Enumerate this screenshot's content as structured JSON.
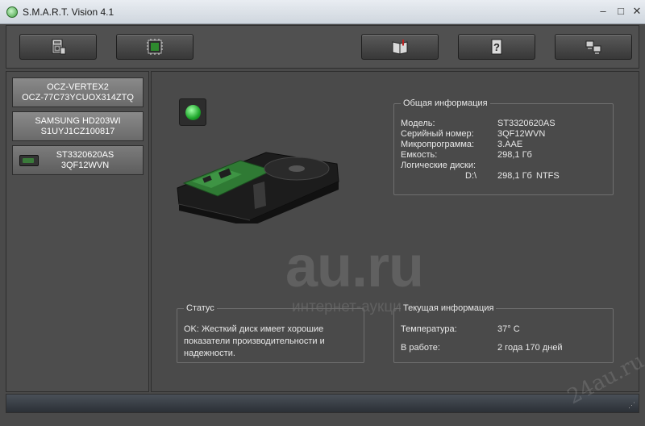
{
  "window": {
    "title": "S.M.A.R.T. Vision 4.1",
    "controls": {
      "minimize": "–",
      "maximize": "□",
      "close": "✕"
    }
  },
  "toolbar": {
    "buttons": [
      {
        "id": "drives",
        "icon": "hdd-properties-icon"
      },
      {
        "id": "smart",
        "icon": "chip-icon"
      },
      {
        "id": "book",
        "icon": "book-icon"
      },
      {
        "id": "help",
        "icon": "help-icon"
      },
      {
        "id": "network",
        "icon": "computers-icon"
      }
    ]
  },
  "drives": [
    {
      "line1": "OCZ-VERTEX2",
      "line2": "OCZ-77C73YCUOX314ZTQ",
      "selected": false
    },
    {
      "line1": "SAMSUNG HD203WI",
      "line2": "S1UYJ1CZ100817",
      "selected": false
    },
    {
      "line1": "ST3320620AS",
      "line2": "3QF12WVN",
      "selected": true
    }
  ],
  "general_info": {
    "legend": "Общая информация",
    "model_label": "Модель:",
    "model_value": "ST3320620AS",
    "serial_label": "Серийный номер:",
    "serial_value": "3QF12WVN",
    "firmware_label": "Микропрограмма:",
    "firmware_value": "3.AAE",
    "capacity_label": "Емкость:",
    "capacity_value": "298,1 Гб",
    "logical_label": "Логические диски:",
    "logical_drive": "D:\\",
    "logical_size": "298,1 Гб",
    "logical_fs": "NTFS"
  },
  "status": {
    "legend": "Статус",
    "text": "OK: Жесткий диск имеет хорошие показатели производительности и надежности."
  },
  "current_info": {
    "legend": "Текущая информация",
    "temp_label": "Температура:",
    "temp_value": "37° C",
    "uptime_label": "В работе:",
    "uptime_value": "2 года 170 дней"
  },
  "watermark": {
    "big": "au.ru",
    "sub": "интернет-аукцион",
    "corner": "24au.ru"
  },
  "colors": {
    "status_ok": "#1ea62b"
  }
}
